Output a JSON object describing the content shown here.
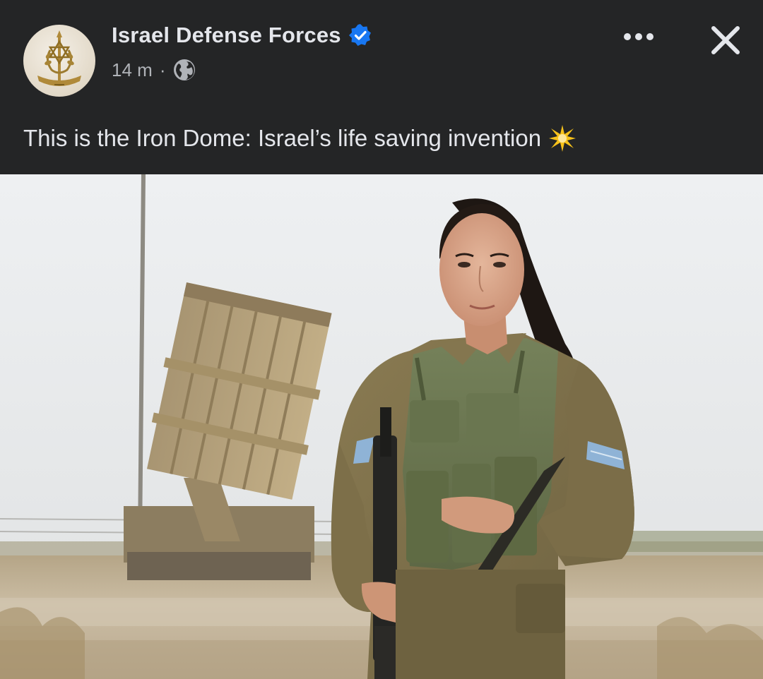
{
  "post": {
    "author": "Israel Defense Forces",
    "timestamp": "14 m",
    "separator": "·",
    "audience_icon": "globe-icon",
    "verified_icon": "verified-badge-icon",
    "text": "This is the Iron Dome: Israel’s life saving invention",
    "emoji_icon": "sparkle-icon"
  },
  "actions": {
    "more_icon": "more-options-icon",
    "close_icon": "close-icon"
  },
  "colors": {
    "background": "#242526",
    "primary_text": "#e4e6eb",
    "secondary_text": "#b0b3b8",
    "verified_blue": "#1877f2"
  }
}
